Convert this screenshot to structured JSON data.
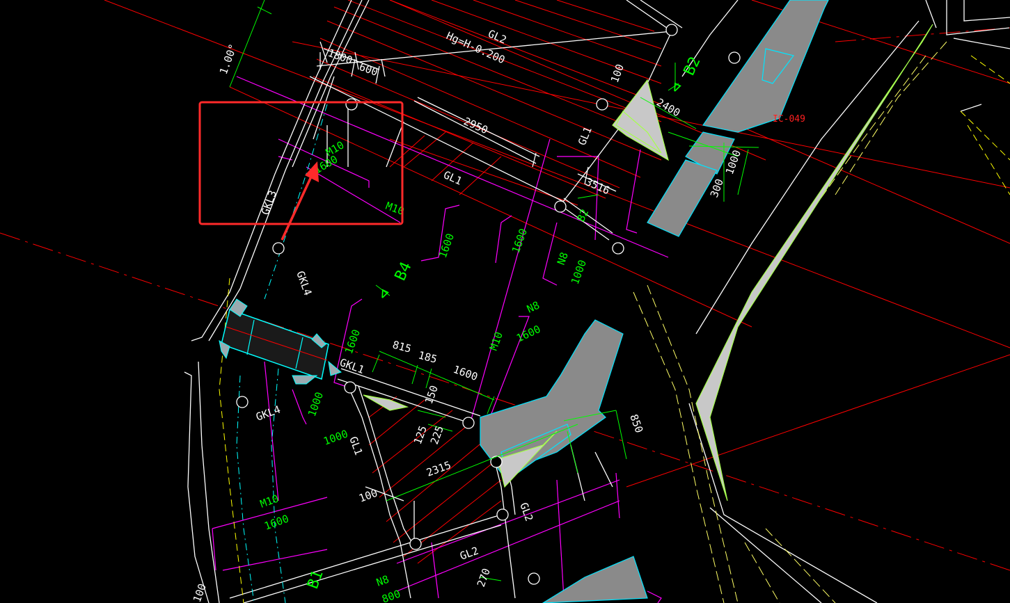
{
  "drawing": {
    "beam_labels": {
      "gl2_top": "GL2",
      "elevation": "Hg=H-0.200",
      "gl1_mid": "GL1",
      "gl1_right": "GL1",
      "gkl3": "GKL3",
      "gkl4_top": "GKL4",
      "gkl1": "GKL1",
      "gkl4_left": "GKL4",
      "gl1_bottom": "GL1",
      "gl2_right": "GL2",
      "gl2_bottom": "GL2"
    },
    "dimensions": {
      "d_1800": "1800",
      "d_600": "600",
      "d_2950": "2950",
      "d_100_top": "100",
      "d_3516": "3516",
      "d_2400": "2400",
      "d_1000_right": "1000",
      "d_300": "300",
      "d_815": "815",
      "d_185": "185",
      "d_1600_mid": "1600",
      "d_150": "150",
      "d_125": "125",
      "d_225": "225",
      "d_2315": "2315",
      "d_100_left": "100",
      "d_850": "850",
      "d_270": "270",
      "d_100_bl": "100",
      "d_1_00": "1.00°"
    },
    "slab_labels": {
      "b2_top": "B2",
      "b4": "B4",
      "b2_mid": "B2",
      "b1_bottom": "B1"
    },
    "rebar_labels": {
      "m10_top": "M10",
      "n1600_top": "1600",
      "m10_box": "M10",
      "n1600_a": "1600",
      "n1600_b": "1600",
      "n8_a": "N8",
      "n1000_a": "1000",
      "n8_b": "N8",
      "n1600_c": "1600",
      "m10_mid": "M10",
      "n1600_d": "1600",
      "n1000_b": "1000",
      "n1000_c": "1000",
      "m10_bottom": "M10",
      "n1600_e": "1600",
      "n8_bottom": "N8",
      "n800_bottom": "800"
    },
    "tags": {
      "ic_049": "IC-049"
    }
  },
  "annotation": {
    "highlight_color": "#ff2a2a",
    "arrow_color": "#ff2a2a"
  },
  "colors": {
    "background": "#000000",
    "beam_lines": "#ffffff",
    "grid_axis": "#ff0000",
    "dimension": "#00ff00",
    "rebar": "#ff00ff",
    "section": "#00ffff",
    "wall_fill": "#8a8a8a"
  }
}
